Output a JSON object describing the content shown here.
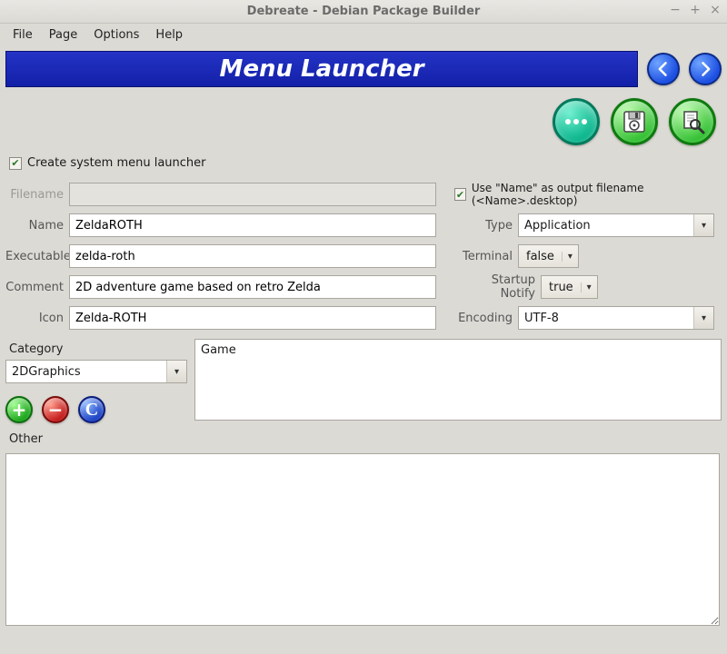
{
  "window": {
    "title": "Debreate - Debian Package Builder",
    "min_icon": "−",
    "max_icon": "+",
    "close_icon": "×"
  },
  "menus": {
    "file": "File",
    "page": "Page",
    "options": "Options",
    "help": "Help"
  },
  "banner": {
    "title": "Menu Launcher"
  },
  "nav": {
    "prev_icon": "arrow-left",
    "next_icon": "arrow-right"
  },
  "toolbar": {
    "more_icon": "more",
    "save_icon": "save",
    "preview_icon": "preview"
  },
  "checkboxes": {
    "create_launcher": {
      "label": "Create system menu launcher",
      "checked": true
    },
    "use_name_filename": {
      "label": "Use \"Name\" as output filename (<Name>.desktop)",
      "checked": true
    }
  },
  "fields": {
    "filename": {
      "label": "Filename",
      "value": ""
    },
    "name": {
      "label": "Name",
      "value": "ZeldaROTH"
    },
    "executable": {
      "label": "Executable",
      "value": "zelda-roth"
    },
    "comment": {
      "label": "Comment",
      "value": "2D adventure game based on retro Zelda"
    },
    "icon": {
      "label": "Icon",
      "value": "Zelda-ROTH"
    },
    "type": {
      "label": "Type",
      "value": "Application"
    },
    "terminal": {
      "label": "Terminal",
      "value": "false"
    },
    "startup": {
      "label": "Startup Notify",
      "value": "true"
    },
    "encoding": {
      "label": "Encoding",
      "value": "UTF-8"
    }
  },
  "category": {
    "label": "Category",
    "selected": "2DGraphics",
    "listed": "Game"
  },
  "buttons": {
    "add": "+",
    "remove": "−",
    "clear": "C"
  },
  "other": {
    "label": "Other",
    "value": ""
  }
}
